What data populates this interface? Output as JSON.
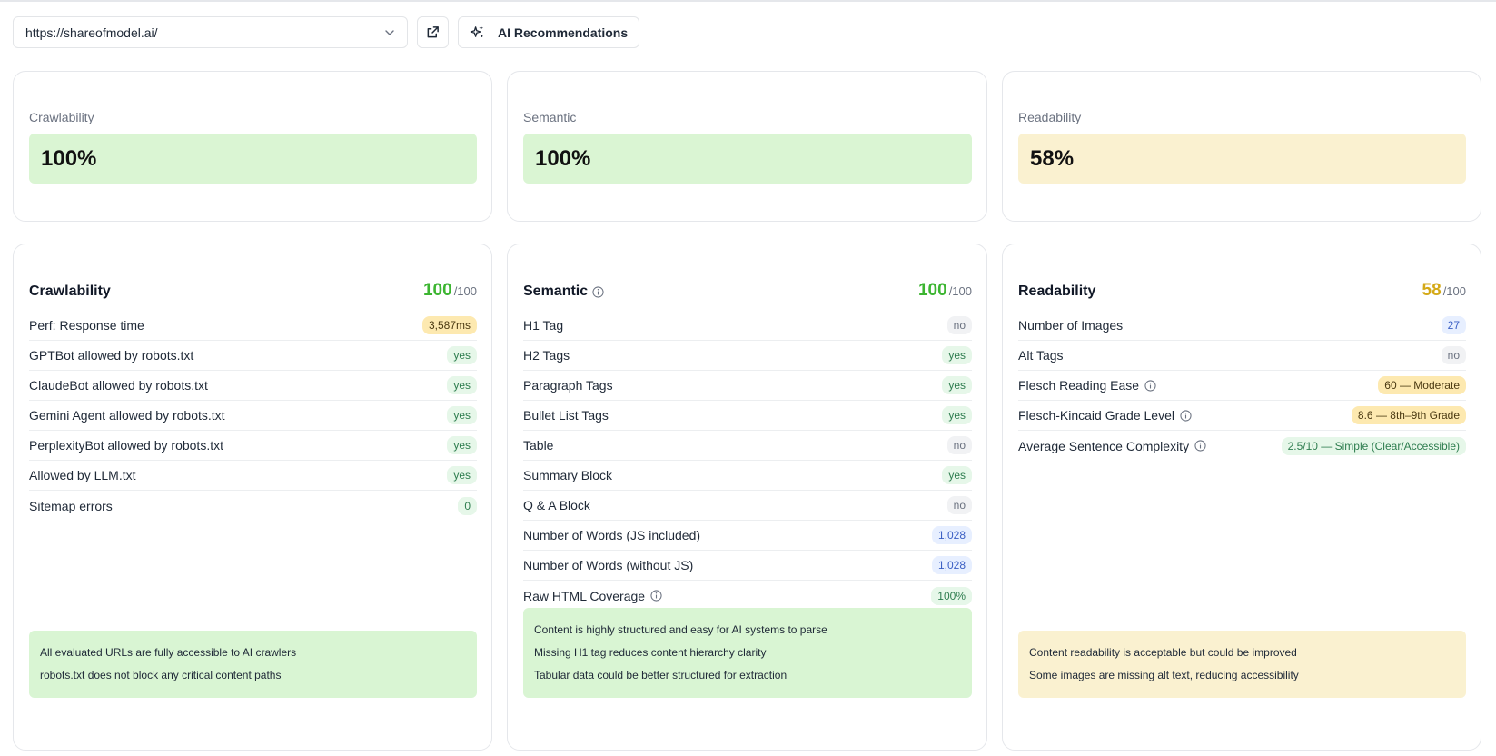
{
  "toolbar": {
    "url_value": "https://shareofmodel.ai/",
    "ai_button_label": "AI Recommendations"
  },
  "score_cards": [
    {
      "label": "Crawlability",
      "value": "100%",
      "color": "#daf5d3"
    },
    {
      "label": "Semantic",
      "value": "100%",
      "color": "#daf5d3"
    },
    {
      "label": "Readability",
      "value": "58%",
      "color": "#faf1d0"
    }
  ],
  "crawlability": {
    "title": "Crawlability",
    "score": "100",
    "score_den": "/100",
    "score_color": "#3cb531",
    "rows": [
      {
        "label": "Perf: Response time",
        "value": "3,587ms",
        "tone": "yellow"
      },
      {
        "label": "GPTBot allowed by robots.txt",
        "value": "yes",
        "tone": "green"
      },
      {
        "label": "ClaudeBot allowed by robots.txt",
        "value": "yes",
        "tone": "green"
      },
      {
        "label": "Gemini Agent allowed by robots.txt",
        "value": "yes",
        "tone": "green"
      },
      {
        "label": "PerplexityBot allowed by robots.txt",
        "value": "yes",
        "tone": "green"
      },
      {
        "label": "Allowed by LLM.txt",
        "value": "yes",
        "tone": "green"
      },
      {
        "label": "Sitemap errors",
        "value": "0",
        "tone": "green"
      }
    ],
    "summary": [
      "All evaluated URLs are fully accessible to AI crawlers",
      "robots.txt does not block any critical content paths"
    ]
  },
  "semantic": {
    "title": "Semantic",
    "score": "100",
    "score_den": "/100",
    "score_color": "#3cb531",
    "rows": [
      {
        "label": "H1 Tag",
        "value": "no",
        "tone": "gray"
      },
      {
        "label": "H2 Tags",
        "value": "yes",
        "tone": "green"
      },
      {
        "label": "Paragraph Tags",
        "value": "yes",
        "tone": "green"
      },
      {
        "label": "Bullet List Tags",
        "value": "yes",
        "tone": "green"
      },
      {
        "label": "Table",
        "value": "no",
        "tone": "gray"
      },
      {
        "label": "Summary Block",
        "value": "yes",
        "tone": "green"
      },
      {
        "label": "Q & A Block",
        "value": "no",
        "tone": "gray"
      },
      {
        "label": "Number of Words (JS included)",
        "value": "1,028",
        "tone": "blue"
      },
      {
        "label": "Number of Words (without JS)",
        "value": "1,028",
        "tone": "blue"
      },
      {
        "label": "Raw HTML Coverage",
        "value": "100%",
        "tone": "green",
        "info": true
      }
    ],
    "summary": [
      "Content is highly structured and easy for AI systems to parse",
      "Missing H1 tag reduces content hierarchy clarity",
      "Tabular data could be better structured for extraction"
    ]
  },
  "readability": {
    "title": "Readability",
    "score": "58",
    "score_den": "/100",
    "score_color": "#d4a917",
    "rows": [
      {
        "label": "Number of Images",
        "value": "27",
        "tone": "blue"
      },
      {
        "label": "Alt Tags",
        "value": "no",
        "tone": "gray"
      },
      {
        "label": "Flesch Reading Ease",
        "value": "60 — Moderate",
        "tone": "yellow",
        "info": true
      },
      {
        "label": "Flesch-Kincaid Grade Level",
        "value": "8.6 — 8th–9th Grade",
        "tone": "yellow",
        "info": true
      },
      {
        "label": "Average Sentence Complexity",
        "value": "2.5/10 — Simple (Clear/Accessible)",
        "tone": "green",
        "info": true
      }
    ],
    "summary": [
      "Content readability is acceptable but could be improved",
      "Some images are missing alt text, reducing accessibility"
    ]
  }
}
